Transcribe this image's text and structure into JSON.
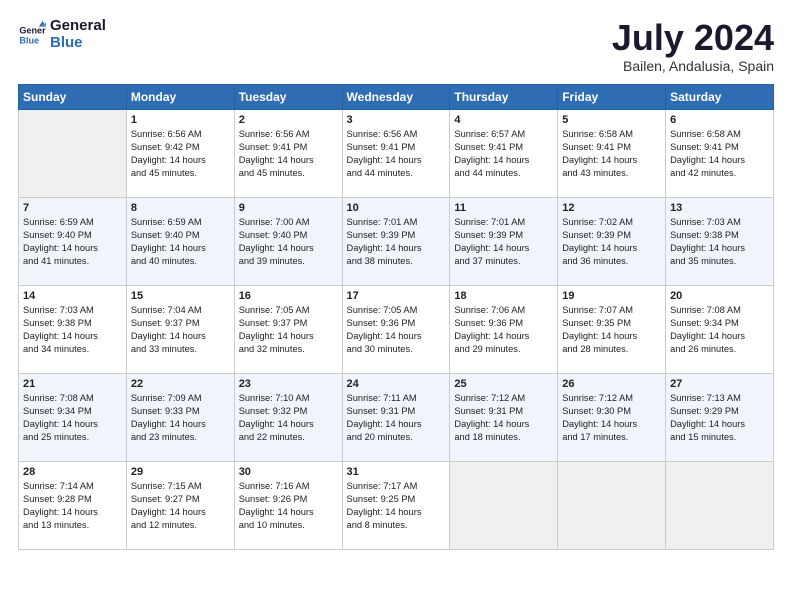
{
  "header": {
    "logo_line1": "General",
    "logo_line2": "Blue",
    "title": "July 2024",
    "subtitle": "Bailen, Andalusia, Spain"
  },
  "days_of_week": [
    "Sunday",
    "Monday",
    "Tuesday",
    "Wednesday",
    "Thursday",
    "Friday",
    "Saturday"
  ],
  "weeks": [
    [
      {
        "num": "",
        "text": ""
      },
      {
        "num": "1",
        "text": "Sunrise: 6:56 AM\nSunset: 9:42 PM\nDaylight: 14 hours\nand 45 minutes."
      },
      {
        "num": "2",
        "text": "Sunrise: 6:56 AM\nSunset: 9:41 PM\nDaylight: 14 hours\nand 45 minutes."
      },
      {
        "num": "3",
        "text": "Sunrise: 6:56 AM\nSunset: 9:41 PM\nDaylight: 14 hours\nand 44 minutes."
      },
      {
        "num": "4",
        "text": "Sunrise: 6:57 AM\nSunset: 9:41 PM\nDaylight: 14 hours\nand 44 minutes."
      },
      {
        "num": "5",
        "text": "Sunrise: 6:58 AM\nSunset: 9:41 PM\nDaylight: 14 hours\nand 43 minutes."
      },
      {
        "num": "6",
        "text": "Sunrise: 6:58 AM\nSunset: 9:41 PM\nDaylight: 14 hours\nand 42 minutes."
      }
    ],
    [
      {
        "num": "7",
        "text": "Sunrise: 6:59 AM\nSunset: 9:40 PM\nDaylight: 14 hours\nand 41 minutes."
      },
      {
        "num": "8",
        "text": "Sunrise: 6:59 AM\nSunset: 9:40 PM\nDaylight: 14 hours\nand 40 minutes."
      },
      {
        "num": "9",
        "text": "Sunrise: 7:00 AM\nSunset: 9:40 PM\nDaylight: 14 hours\nand 39 minutes."
      },
      {
        "num": "10",
        "text": "Sunrise: 7:01 AM\nSunset: 9:39 PM\nDaylight: 14 hours\nand 38 minutes."
      },
      {
        "num": "11",
        "text": "Sunrise: 7:01 AM\nSunset: 9:39 PM\nDaylight: 14 hours\nand 37 minutes."
      },
      {
        "num": "12",
        "text": "Sunrise: 7:02 AM\nSunset: 9:39 PM\nDaylight: 14 hours\nand 36 minutes."
      },
      {
        "num": "13",
        "text": "Sunrise: 7:03 AM\nSunset: 9:38 PM\nDaylight: 14 hours\nand 35 minutes."
      }
    ],
    [
      {
        "num": "14",
        "text": "Sunrise: 7:03 AM\nSunset: 9:38 PM\nDaylight: 14 hours\nand 34 minutes."
      },
      {
        "num": "15",
        "text": "Sunrise: 7:04 AM\nSunset: 9:37 PM\nDaylight: 14 hours\nand 33 minutes."
      },
      {
        "num": "16",
        "text": "Sunrise: 7:05 AM\nSunset: 9:37 PM\nDaylight: 14 hours\nand 32 minutes."
      },
      {
        "num": "17",
        "text": "Sunrise: 7:05 AM\nSunset: 9:36 PM\nDaylight: 14 hours\nand 30 minutes."
      },
      {
        "num": "18",
        "text": "Sunrise: 7:06 AM\nSunset: 9:36 PM\nDaylight: 14 hours\nand 29 minutes."
      },
      {
        "num": "19",
        "text": "Sunrise: 7:07 AM\nSunset: 9:35 PM\nDaylight: 14 hours\nand 28 minutes."
      },
      {
        "num": "20",
        "text": "Sunrise: 7:08 AM\nSunset: 9:34 PM\nDaylight: 14 hours\nand 26 minutes."
      }
    ],
    [
      {
        "num": "21",
        "text": "Sunrise: 7:08 AM\nSunset: 9:34 PM\nDaylight: 14 hours\nand 25 minutes."
      },
      {
        "num": "22",
        "text": "Sunrise: 7:09 AM\nSunset: 9:33 PM\nDaylight: 14 hours\nand 23 minutes."
      },
      {
        "num": "23",
        "text": "Sunrise: 7:10 AM\nSunset: 9:32 PM\nDaylight: 14 hours\nand 22 minutes."
      },
      {
        "num": "24",
        "text": "Sunrise: 7:11 AM\nSunset: 9:31 PM\nDaylight: 14 hours\nand 20 minutes."
      },
      {
        "num": "25",
        "text": "Sunrise: 7:12 AM\nSunset: 9:31 PM\nDaylight: 14 hours\nand 18 minutes."
      },
      {
        "num": "26",
        "text": "Sunrise: 7:12 AM\nSunset: 9:30 PM\nDaylight: 14 hours\nand 17 minutes."
      },
      {
        "num": "27",
        "text": "Sunrise: 7:13 AM\nSunset: 9:29 PM\nDaylight: 14 hours\nand 15 minutes."
      }
    ],
    [
      {
        "num": "28",
        "text": "Sunrise: 7:14 AM\nSunset: 9:28 PM\nDaylight: 14 hours\nand 13 minutes."
      },
      {
        "num": "29",
        "text": "Sunrise: 7:15 AM\nSunset: 9:27 PM\nDaylight: 14 hours\nand 12 minutes."
      },
      {
        "num": "30",
        "text": "Sunrise: 7:16 AM\nSunset: 9:26 PM\nDaylight: 14 hours\nand 10 minutes."
      },
      {
        "num": "31",
        "text": "Sunrise: 7:17 AM\nSunset: 9:25 PM\nDaylight: 14 hours\nand 8 minutes."
      },
      {
        "num": "",
        "text": ""
      },
      {
        "num": "",
        "text": ""
      },
      {
        "num": "",
        "text": ""
      }
    ]
  ]
}
